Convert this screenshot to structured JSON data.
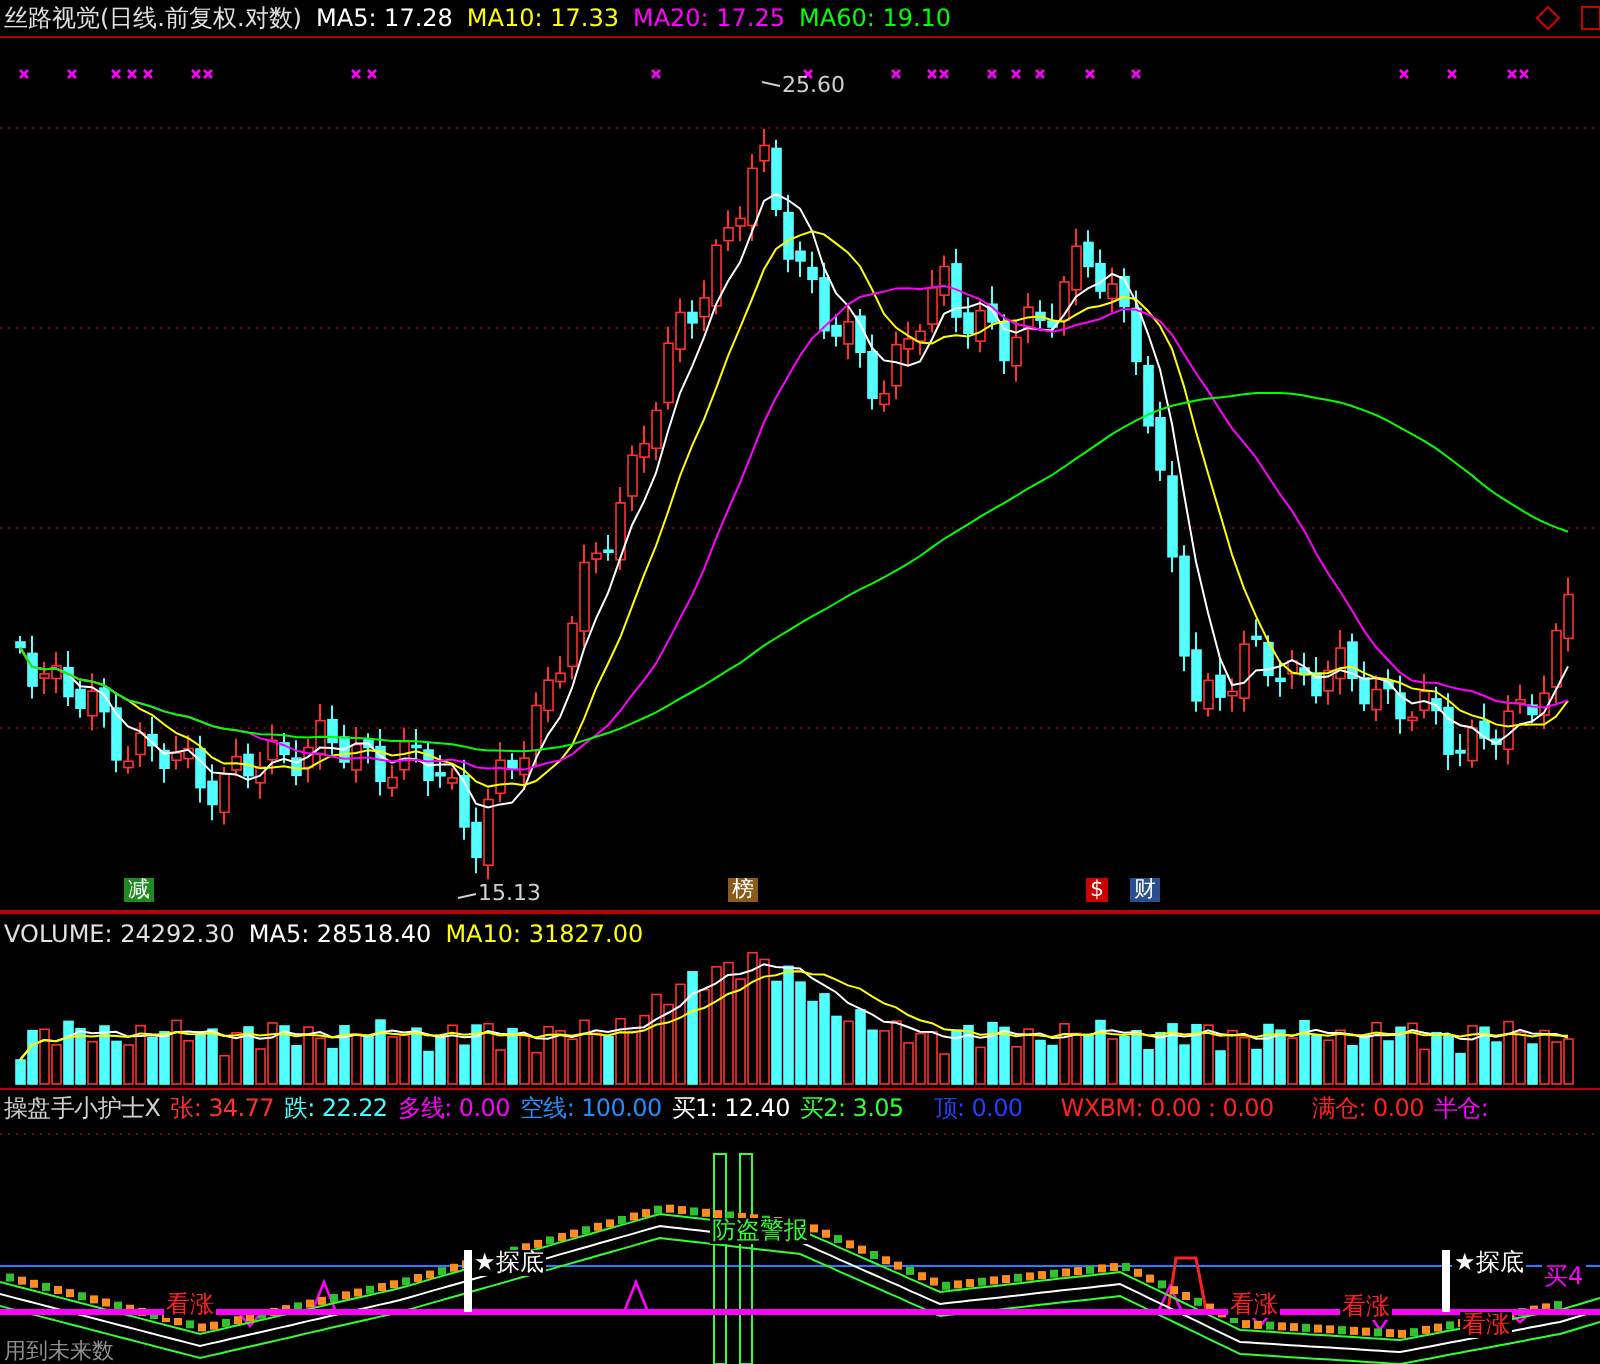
{
  "main_chart": {
    "title": "丝路视觉(日线.前复权.对数)",
    "averages": [
      {
        "label": "MA5: 17.28",
        "color": "#ffffff"
      },
      {
        "label": "MA10: 17.33",
        "color": "#ffff00"
      },
      {
        "label": "MA20: 17.25",
        "color": "#ff00ff"
      },
      {
        "label": "MA60: 19.10",
        "color": "#00ff00"
      }
    ],
    "high_label": "25.60",
    "low_label": "15.13",
    "event_markers": [
      {
        "text": "减",
        "color": "#1f8a1f"
      },
      {
        "text": "榜",
        "color": "#8a5a1a"
      },
      {
        "text": "$",
        "color": "#cc0000"
      },
      {
        "text": "财",
        "color": "#2a4f8f"
      }
    ]
  },
  "volume_panel": {
    "title": "VOLUME: 24292.30",
    "averages": [
      {
        "label": "MA5: 28518.40",
        "color": "#ffffff"
      },
      {
        "label": "MA10: 31827.00",
        "color": "#ffff00"
      }
    ]
  },
  "indicator_panel": {
    "title": "操盘手小护士X",
    "readings": [
      {
        "label": "张: 34.77",
        "color": "#ff3030"
      },
      {
        "label": "跌: 22.22",
        "color": "#40ffff"
      },
      {
        "label": "多线: 0.00",
        "color": "#ff00ff"
      },
      {
        "label": "空线: 100.00",
        "color": "#2090ff"
      },
      {
        "label": "买1: 12.40",
        "color": "#ffffff"
      },
      {
        "label": "买2: 3.05",
        "color": "#30ff30"
      },
      {
        "label": "顶: 0.00",
        "color": "#2040ff"
      },
      {
        "label": "WXBM: 0.00 : 0.00",
        "color": "#ff2020"
      },
      {
        "label": "满仓: 0.00",
        "color": "#ff2020"
      },
      {
        "label": "半仓:",
        "color": "#ff00ff"
      }
    ],
    "signals": [
      {
        "kind": "rise",
        "text": "看涨"
      },
      {
        "kind": "bottom",
        "text": "★探底"
      },
      {
        "kind": "alarm",
        "text": "防盗警报"
      },
      {
        "kind": "rise",
        "text": "看涨"
      },
      {
        "kind": "rise",
        "text": "看涨"
      },
      {
        "kind": "bottom",
        "text": "★探底"
      },
      {
        "kind": "rise",
        "text": "看涨"
      },
      {
        "kind": "buy",
        "text": "买4"
      }
    ],
    "footnote": "用到未来数"
  }
}
